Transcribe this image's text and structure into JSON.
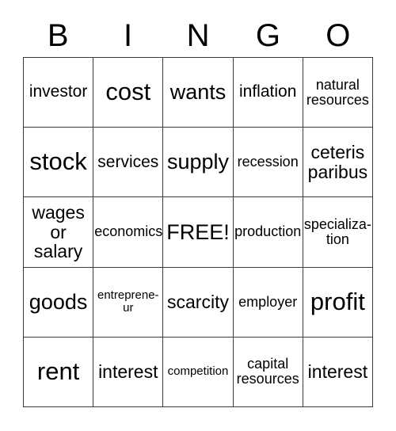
{
  "card": {
    "type": "bingo-card",
    "topic": "economics",
    "header_letters": [
      "B",
      "I",
      "N",
      "G",
      "O"
    ],
    "grid_size": 5,
    "free_space": {
      "row": 2,
      "column": 2,
      "label": "FREE!"
    },
    "colors": {
      "background": "#ffffff",
      "text": "#000000",
      "grid_line": "#3a3a3a"
    },
    "rows": [
      [
        {
          "label": "investor",
          "size": "sm"
        },
        {
          "label": "cost",
          "size": "xl"
        },
        {
          "label": "wants",
          "size": "lg"
        },
        {
          "label": "inflation",
          "size": "sm"
        },
        {
          "label": "natural resources",
          "size": "xs"
        }
      ],
      [
        {
          "label": "stock",
          "size": "xl"
        },
        {
          "label": "services",
          "size": "sm"
        },
        {
          "label": "supply",
          "size": "lg"
        },
        {
          "label": "recession",
          "size": "xs"
        },
        {
          "label": "ceteris paribus",
          "size": "md"
        }
      ],
      [
        {
          "label": "wages\nor\nsalary",
          "size": "md"
        },
        {
          "label": "economics",
          "size": "xs"
        },
        {
          "label": "FREE!",
          "size": "lg"
        },
        {
          "label": "production",
          "size": "xs"
        },
        {
          "label": "specializa-\ntion",
          "size": "xs"
        }
      ],
      [
        {
          "label": "goods",
          "size": "lg"
        },
        {
          "label": "entreprene-\nur",
          "size": "xxs"
        },
        {
          "label": "scarcity",
          "size": "md"
        },
        {
          "label": "employer",
          "size": "xs"
        },
        {
          "label": "profit",
          "size": "xl"
        }
      ],
      [
        {
          "label": "rent",
          "size": "xl"
        },
        {
          "label": "interest",
          "size": "md"
        },
        {
          "label": "competition",
          "size": "xxs"
        },
        {
          "label": "capital\nresources",
          "size": "xs"
        },
        {
          "label": "interest",
          "size": "md"
        }
      ]
    ]
  }
}
